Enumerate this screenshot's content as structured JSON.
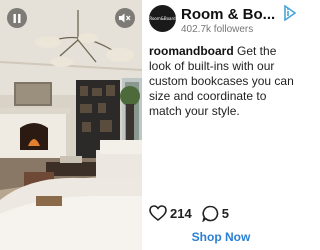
{
  "ad": {
    "brand_name": "Room & Bo...",
    "followers": "402.7k followers",
    "logo_text": "Room&Board",
    "caption_handle": "roomandboard",
    "caption_text": " Get the look of built-ins with our custom bookcases you can size and coordinate to match your style.",
    "likes": "214",
    "comments": "5",
    "cta_label": "Shop Now"
  },
  "icons": {
    "pause": "pause-icon",
    "mute": "mute-icon",
    "adchoices": "adchoices-icon",
    "heart": "heart-icon",
    "comment": "comment-icon"
  },
  "colors": {
    "cta": "#2a7fd4",
    "text": "#222222",
    "muted": "#777777"
  }
}
